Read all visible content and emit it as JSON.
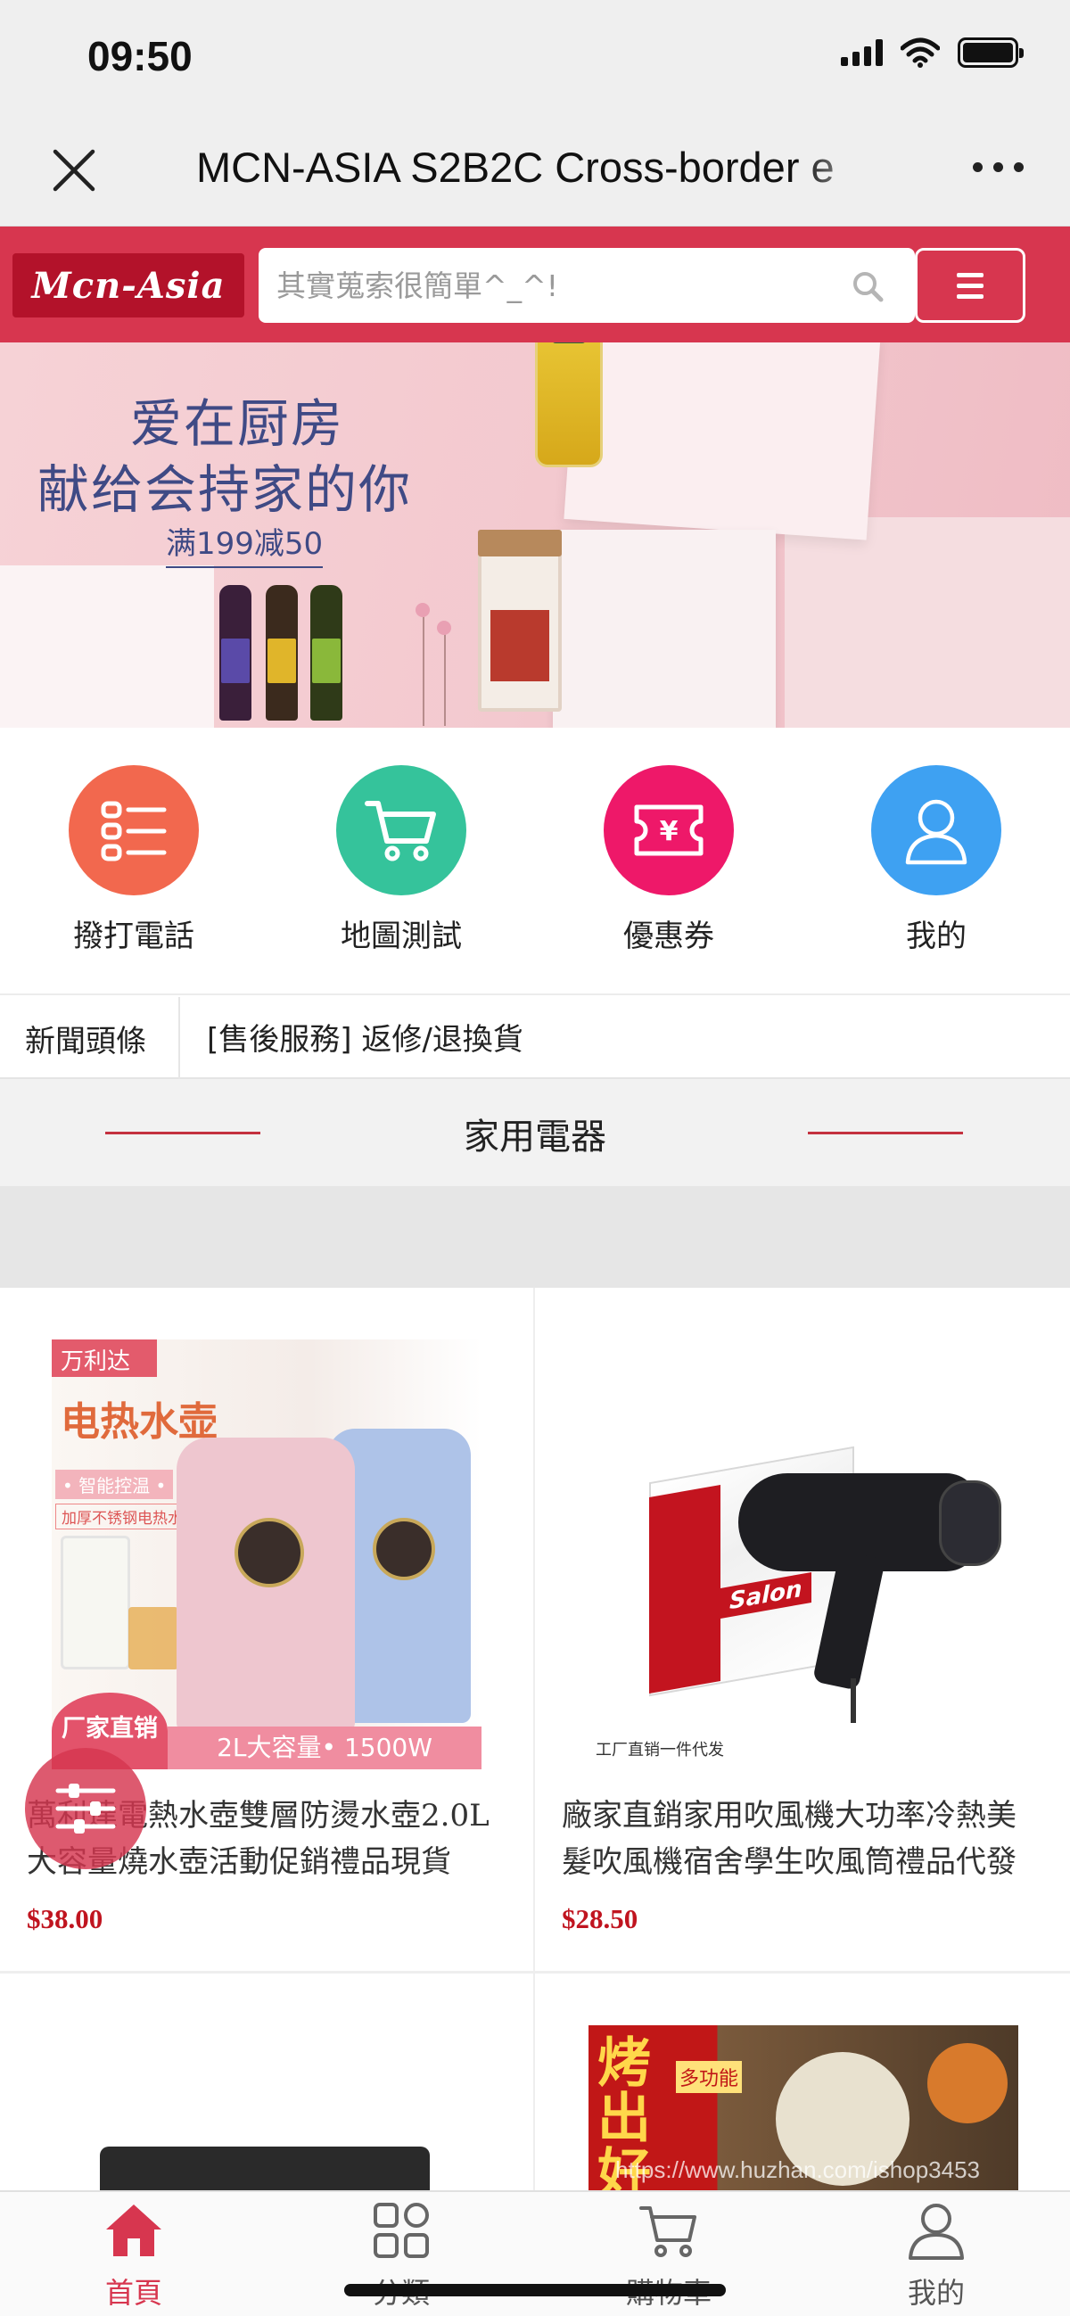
{
  "status_bar": {
    "time": "09:50"
  },
  "title_bar": {
    "title": "MCN-ASIA S2B2C Cross-border e"
  },
  "header": {
    "logo_text": "Mcn-Asia",
    "search_placeholder": "其實蒐索很簡單^_^!"
  },
  "banner": {
    "line1": "爱在厨房",
    "line2": "献给会持家的你",
    "line3": "满199减50"
  },
  "quick_nav": [
    {
      "label": "撥打電話",
      "icon": "list-icon",
      "color": "#f2684e"
    },
    {
      "label": "地圖測試",
      "icon": "cart-icon",
      "color": "#35c39b"
    },
    {
      "label": "優惠券",
      "icon": "coupon-icon",
      "color": "#ee1869"
    },
    {
      "label": "我的",
      "icon": "user-icon",
      "color": "#3ea1f2"
    }
  ],
  "news": {
    "label": "新聞頭條",
    "headline": "[售後服務] 返修/退換貨"
  },
  "section": {
    "title": "家用電器"
  },
  "products": [
    {
      "name": "萬利達電熱水壺雙層防燙水壺2.0L大容量燒水壺活動促銷禮品現貨",
      "price": "$38.00",
      "img_brand": "万利达",
      "img_title": "电热水壶",
      "img_tag1": "• 智能控温 •",
      "img_tag2": "加厚不锈钢电热水壶",
      "img_badge": "厂家直销",
      "img_footer": "2L大容量• 1500W"
    },
    {
      "name": "廠家直銷家用吹風機大功率冷熱美髮吹風機宿舍學生吹風筒禮品代發",
      "price": "$28.50",
      "img_box_text": "Salon",
      "img_caption": "工厂直销一件代发"
    },
    {
      "name": "",
      "price": ""
    },
    {
      "name": "",
      "price": "",
      "img_title": "烤出好",
      "img_tag": "多功能"
    }
  ],
  "watermark": "https://www.huzhan.com/ishop3453",
  "tab_bar": [
    {
      "label": "首頁",
      "icon": "home-icon",
      "active": true
    },
    {
      "label": "分類",
      "icon": "category-icon",
      "active": false
    },
    {
      "label": "購物車",
      "icon": "cart-icon",
      "active": false
    },
    {
      "label": "我的",
      "icon": "user-icon",
      "active": false
    }
  ],
  "colors": {
    "brand_red": "#d7364f",
    "price_red": "#c0141f",
    "section_line": "#c4313f"
  }
}
